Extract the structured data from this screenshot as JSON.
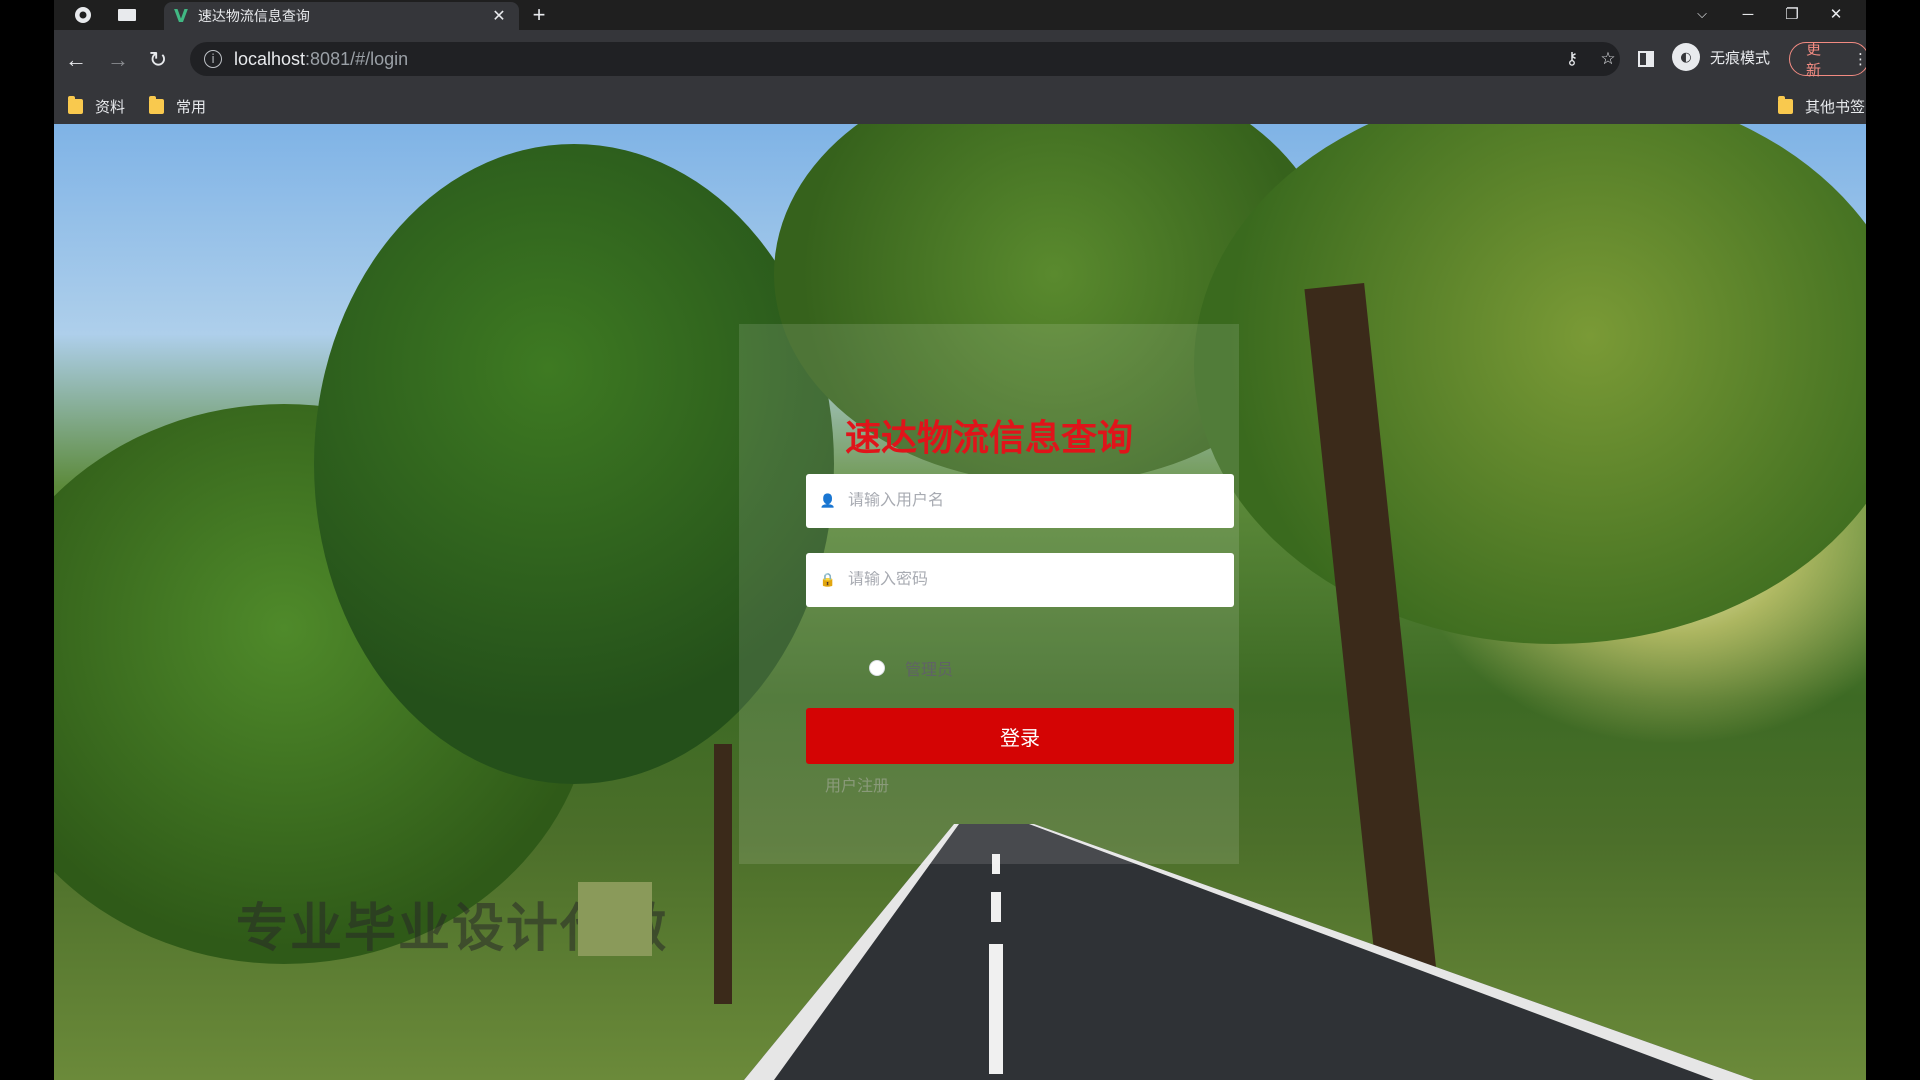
{
  "browser": {
    "tab": {
      "title": "速达物流信息查询"
    },
    "address": {
      "host": "localhost",
      "path": ":8081/#/login"
    },
    "incognito_label": "无痕模式",
    "update_label": "更新",
    "bookmarks": [
      {
        "label": "资料"
      },
      {
        "label": "常用"
      }
    ],
    "other_bookmarks": "其他书签"
  },
  "login": {
    "title": "速达物流信息查询",
    "username_placeholder": "请输入用户名",
    "password_placeholder": "请输入密码",
    "role_label": "管理员",
    "submit_label": "登录",
    "register_link": "用户注册"
  },
  "watermark": "专业毕业设计代做",
  "colors": {
    "title_red": "#e0141a",
    "button_red": "#d40404",
    "tab_strip": "#1f1f1f",
    "toolbar": "#35363a"
  },
  "icons": [
    "chrome-icon",
    "window-icon",
    "vue-favicon",
    "close-icon",
    "plus-icon",
    "back-icon",
    "forward-icon",
    "reload-icon",
    "info-icon",
    "key-icon",
    "star-icon",
    "sidepanel-icon",
    "incognito-icon",
    "user-icon",
    "lock-icon"
  ]
}
